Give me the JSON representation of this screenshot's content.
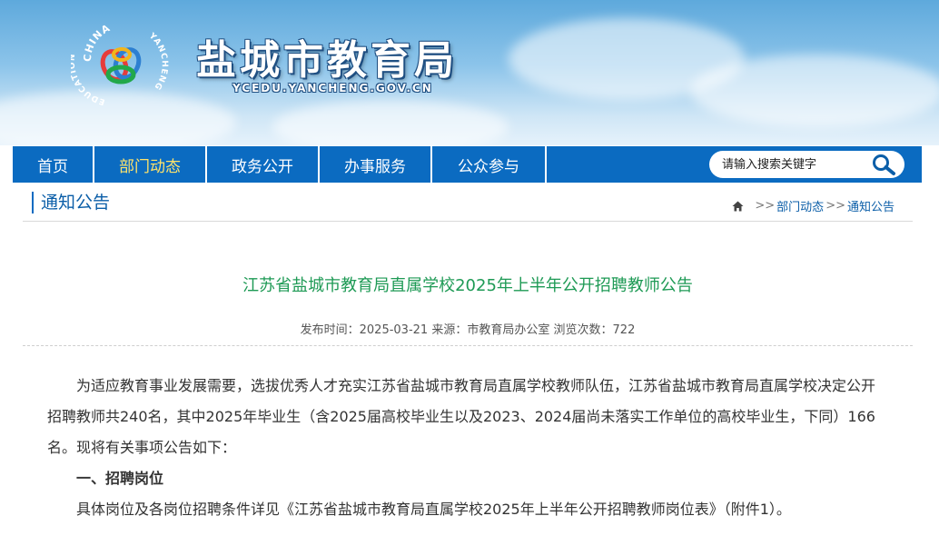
{
  "header": {
    "site_title": "盐城市教育局",
    "site_domain": "YCEDU.YANCHENG.GOV.CN",
    "logo_text_top": "CHINA",
    "logo_text_left": "EDUCATION",
    "logo_text_right": "YANCHENG"
  },
  "nav": {
    "items": [
      {
        "label": "首页"
      },
      {
        "label": "部门动态"
      },
      {
        "label": "政务公开"
      },
      {
        "label": "办事服务"
      },
      {
        "label": "公众参与"
      }
    ],
    "active_index": 1
  },
  "search": {
    "placeholder": "请输入搜索关键字",
    "icon": "search-icon"
  },
  "section": {
    "title": "通知公告"
  },
  "breadcrumb": {
    "home_icon": "home-icon",
    "separator": ">>",
    "items": [
      "部门动态",
      "通知公告"
    ]
  },
  "article": {
    "title": "江苏省盐城市教育局直属学校2025年上半年公开招聘教师公告",
    "meta": {
      "publish_label": "发布时间：",
      "publish_date": "2025-03-21",
      "source_label": "来源：",
      "source": "市教育局办公室",
      "views_label": "浏览次数：",
      "views": "722"
    },
    "paragraphs": [
      "为适应教育事业发展需要，选拔优秀人才充实江苏省盐城市教育局直属学校教师队伍，江苏省盐城市教育局直属学校决定公开招聘教师共240名，其中2025年毕业生（含2025届高校毕业生以及2023、2024届尚未落实工作单位的高校毕业生，下同）166名。现将有关事项公告如下：",
      "一、招聘岗位",
      "具体岗位及各岗位招聘条件详见《江苏省盐城市教育局直属学校2025年上半年公开招聘教师岗位表》（附件1）。"
    ]
  },
  "colors": {
    "nav_bg": "#0b6bc1",
    "nav_active": "#ffe36a",
    "title_green": "#1e9a55",
    "link_blue": "#0b5ea8"
  }
}
